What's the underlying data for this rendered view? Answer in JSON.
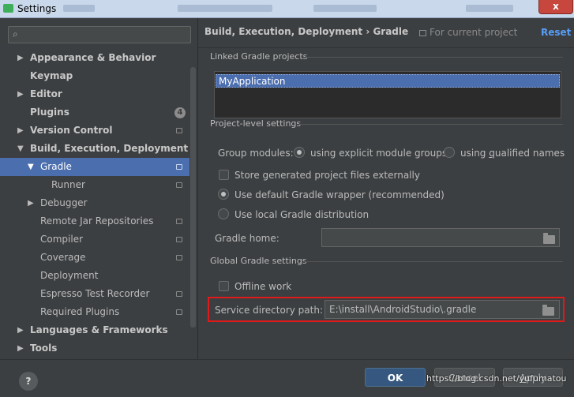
{
  "window": {
    "title": "Settings",
    "close": "x"
  },
  "sidebar": {
    "items": [
      {
        "label": "Appearance & Behavior"
      },
      {
        "label": "Keymap"
      },
      {
        "label": "Editor"
      },
      {
        "label": "Plugins",
        "badge": "4"
      },
      {
        "label": "Version Control"
      },
      {
        "label": "Build, Execution, Deployment"
      },
      {
        "label": "Gradle"
      },
      {
        "label": "Runner"
      },
      {
        "label": "Debugger"
      },
      {
        "label": "Remote Jar Repositories"
      },
      {
        "label": "Compiler"
      },
      {
        "label": "Coverage"
      },
      {
        "label": "Deployment"
      },
      {
        "label": "Espresso Test Recorder"
      },
      {
        "label": "Required Plugins"
      },
      {
        "label": "Languages & Frameworks"
      },
      {
        "label": "Tools"
      }
    ]
  },
  "header": {
    "breadcrumb": "Build, Execution, Deployment  ›  Gradle",
    "current_project": "For current project",
    "reset": "Reset"
  },
  "linked": {
    "section": "Linked Gradle projects",
    "projects": [
      "MyApplication"
    ]
  },
  "project_level": {
    "section": "Project-level settings",
    "group_modules_label": "Group modules:",
    "explicit_groups": "using explicit module groups",
    "qualified_prefix": "using ",
    "qualified_mnemonic": "q",
    "qualified_suffix": "ualified names",
    "store_external": "Store generated project files externally",
    "default_wrapper": "Use default Gradle wrapper (recommended)",
    "local_distribution": "Use local Gradle distribution",
    "gradle_home_label": "Gradle home:",
    "gradle_home_value": ""
  },
  "global": {
    "section": "Global Gradle settings",
    "offline": "Offline work",
    "service_dir_label": "Service directory path:",
    "service_dir_value": "E:\\install\\AndroidStudio\\.gradle"
  },
  "footer": {
    "help": "?",
    "ok": "OK",
    "cancel": "Cancel",
    "apply_mnemonic": "A",
    "apply_rest": "pply"
  },
  "watermark": "https://blog.csdn.net/yufumatou",
  "colors": {
    "background": "#3c3f41",
    "selection": "#4b6eaf",
    "link": "#589df6",
    "highlight_border": "#e0191b",
    "ok_button": "#365880"
  }
}
